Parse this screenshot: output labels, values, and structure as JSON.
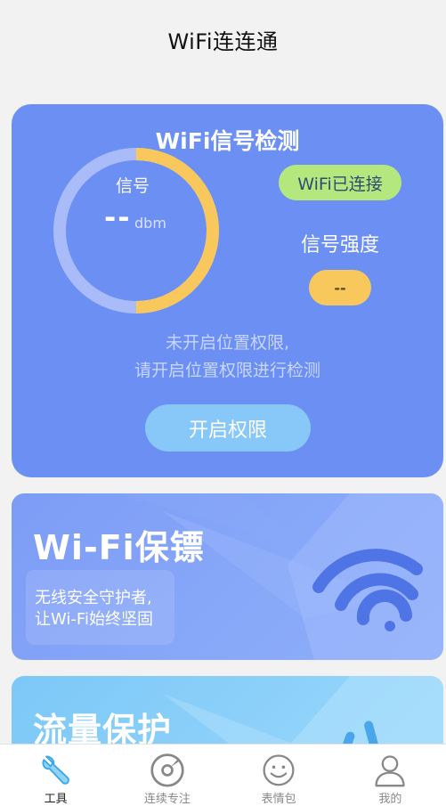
{
  "header": {
    "title": "WiFi连连通"
  },
  "signal_card": {
    "title": "WiFi信号检测",
    "gauge_label": "信号",
    "gauge_value": "--",
    "gauge_unit": "dbm",
    "gauge_level": 0.5,
    "connected_badge": "WiFi已连接",
    "strength_label": "信号强度",
    "strength_value": "--",
    "hint_line1": "未开启位置权限,",
    "hint_line2": "请开启位置权限进行检测",
    "button_label": "开启权限"
  },
  "banners": {
    "guard": {
      "title": "Wi-Fi保镖",
      "line1": "无线安全守护者,",
      "line2": "让Wi-Fi始终坚固"
    },
    "flow": {
      "title": "流量保护"
    }
  },
  "tabbar": {
    "items": [
      {
        "label": "工具",
        "icon": "wrench-icon",
        "active": true
      },
      {
        "label": "连续专注",
        "icon": "focus-disc-icon",
        "active": false
      },
      {
        "label": "表情包",
        "icon": "smiley-icon",
        "active": false
      },
      {
        "label": "我的",
        "icon": "user-icon",
        "active": false
      }
    ]
  },
  "colors": {
    "card_bg": "#6b8ff3",
    "gauge_track": "#a9bcf9",
    "gauge_fill": "#f8c85c",
    "badge_green": "#b4e87f",
    "button_blue": "#87c8f9",
    "active_tab": "#3aa7e8"
  }
}
